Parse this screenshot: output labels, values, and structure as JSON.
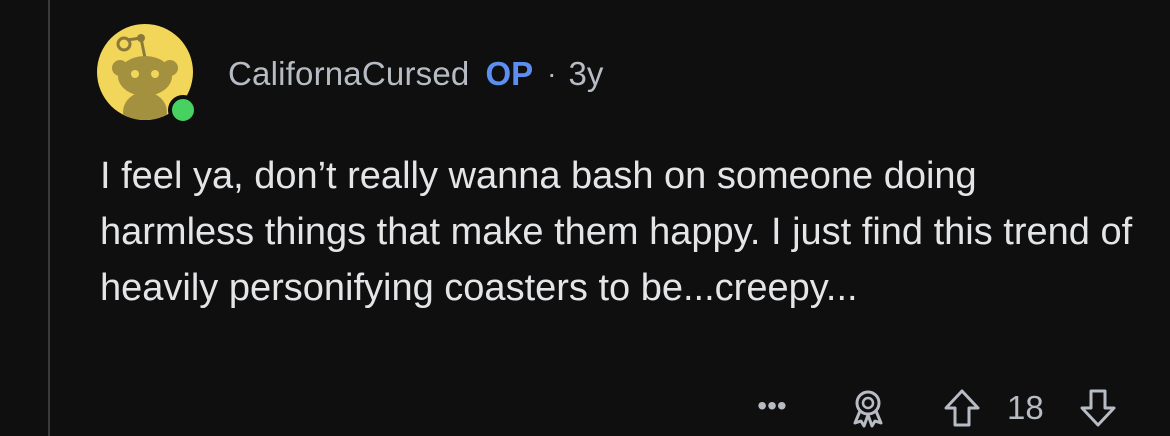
{
  "comment": {
    "author": "CalifornaCursed",
    "op_badge": "OP",
    "separator": "·",
    "age": "3y",
    "body": "I feel ya, don’t really wanna bash on someone doing harmless things that make them happy. I just find this trend of heavily personifying coasters to be...creepy...",
    "avatar_icon": "snoo-avatar-icon",
    "online_status_icon": "online-dot-icon"
  },
  "actions": {
    "more_label": "•••",
    "more_icon": "more-options-icon",
    "award_icon": "award-icon",
    "upvote_icon": "upvote-arrow-icon",
    "score": "18",
    "downvote_icon": "downvote-arrow-icon"
  },
  "colors": {
    "background": "#0f0f10",
    "avatar_bg": "#f2d65a",
    "online": "#46d160",
    "op_badge": "#5b8ff2",
    "meta_text": "#b7bcc4",
    "body_text": "#e4e5e7"
  }
}
